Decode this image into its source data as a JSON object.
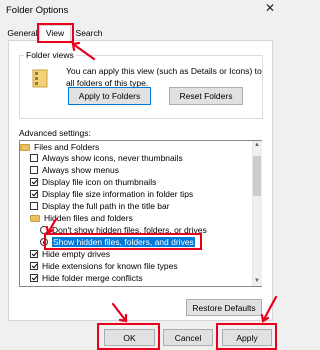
{
  "window": {
    "title": "Folder Options",
    "close_glyph": "✕"
  },
  "tabs": [
    {
      "label": "General"
    },
    {
      "label": "View",
      "selected": true
    },
    {
      "label": "Search"
    }
  ],
  "folder_views": {
    "legend": "Folder views",
    "description": "You can apply this view (such as Details or Icons) to all folders of this type.",
    "apply_button": "Apply to Folders",
    "reset_button": "Reset Folders"
  },
  "advanced": {
    "label": "Advanced settings:",
    "items": [
      {
        "type": "folder",
        "label": "Files and Folders"
      },
      {
        "type": "checkbox",
        "checked": false,
        "label": "Always show icons, never thumbnails"
      },
      {
        "type": "checkbox",
        "checked": false,
        "label": "Always show menus"
      },
      {
        "type": "checkbox",
        "checked": true,
        "label": "Display file icon on thumbnails"
      },
      {
        "type": "checkbox",
        "checked": true,
        "label": "Display file size information in folder tips"
      },
      {
        "type": "checkbox",
        "checked": false,
        "label": "Display the full path in the title bar"
      },
      {
        "type": "folder",
        "label": "Hidden files and folders"
      },
      {
        "type": "radio",
        "selected": false,
        "label": "Don't show hidden files, folders, or drives"
      },
      {
        "type": "radio",
        "selected": true,
        "label": "Show hidden files, folders, and drives"
      },
      {
        "type": "checkbox",
        "checked": true,
        "label": "Hide empty drives"
      },
      {
        "type": "checkbox",
        "checked": true,
        "label": "Hide extensions for known file types"
      },
      {
        "type": "checkbox",
        "checked": true,
        "label": "Hide folder merge conflicts"
      }
    ]
  },
  "buttons": {
    "restore_defaults": "Restore Defaults",
    "ok": "OK",
    "cancel": "Cancel",
    "apply": "Apply"
  },
  "colors": {
    "annotation_red": "#e8001c",
    "selection_blue": "#0078d7"
  }
}
